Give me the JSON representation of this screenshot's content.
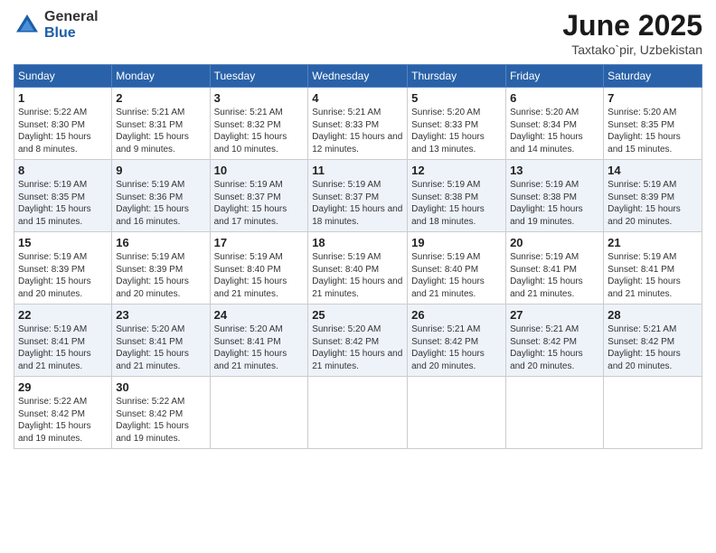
{
  "logo": {
    "general": "General",
    "blue": "Blue"
  },
  "title": "June 2025",
  "location": "Taxtako`pir, Uzbekistan",
  "headers": [
    "Sunday",
    "Monday",
    "Tuesday",
    "Wednesday",
    "Thursday",
    "Friday",
    "Saturday"
  ],
  "weeks": [
    [
      {
        "day": "1",
        "sunrise": "5:22 AM",
        "sunset": "8:30 PM",
        "daylight": "15 hours and 8 minutes."
      },
      {
        "day": "2",
        "sunrise": "5:21 AM",
        "sunset": "8:31 PM",
        "daylight": "15 hours and 9 minutes."
      },
      {
        "day": "3",
        "sunrise": "5:21 AM",
        "sunset": "8:32 PM",
        "daylight": "15 hours and 10 minutes."
      },
      {
        "day": "4",
        "sunrise": "5:21 AM",
        "sunset": "8:33 PM",
        "daylight": "15 hours and 12 minutes."
      },
      {
        "day": "5",
        "sunrise": "5:20 AM",
        "sunset": "8:33 PM",
        "daylight": "15 hours and 13 minutes."
      },
      {
        "day": "6",
        "sunrise": "5:20 AM",
        "sunset": "8:34 PM",
        "daylight": "15 hours and 14 minutes."
      },
      {
        "day": "7",
        "sunrise": "5:20 AM",
        "sunset": "8:35 PM",
        "daylight": "15 hours and 15 minutes."
      }
    ],
    [
      {
        "day": "8",
        "sunrise": "5:19 AM",
        "sunset": "8:35 PM",
        "daylight": "15 hours and 15 minutes."
      },
      {
        "day": "9",
        "sunrise": "5:19 AM",
        "sunset": "8:36 PM",
        "daylight": "15 hours and 16 minutes."
      },
      {
        "day": "10",
        "sunrise": "5:19 AM",
        "sunset": "8:37 PM",
        "daylight": "15 hours and 17 minutes."
      },
      {
        "day": "11",
        "sunrise": "5:19 AM",
        "sunset": "8:37 PM",
        "daylight": "15 hours and 18 minutes."
      },
      {
        "day": "12",
        "sunrise": "5:19 AM",
        "sunset": "8:38 PM",
        "daylight": "15 hours and 18 minutes."
      },
      {
        "day": "13",
        "sunrise": "5:19 AM",
        "sunset": "8:38 PM",
        "daylight": "15 hours and 19 minutes."
      },
      {
        "day": "14",
        "sunrise": "5:19 AM",
        "sunset": "8:39 PM",
        "daylight": "15 hours and 20 minutes."
      }
    ],
    [
      {
        "day": "15",
        "sunrise": "5:19 AM",
        "sunset": "8:39 PM",
        "daylight": "15 hours and 20 minutes."
      },
      {
        "day": "16",
        "sunrise": "5:19 AM",
        "sunset": "8:39 PM",
        "daylight": "15 hours and 20 minutes."
      },
      {
        "day": "17",
        "sunrise": "5:19 AM",
        "sunset": "8:40 PM",
        "daylight": "15 hours and 21 minutes."
      },
      {
        "day": "18",
        "sunrise": "5:19 AM",
        "sunset": "8:40 PM",
        "daylight": "15 hours and 21 minutes."
      },
      {
        "day": "19",
        "sunrise": "5:19 AM",
        "sunset": "8:40 PM",
        "daylight": "15 hours and 21 minutes."
      },
      {
        "day": "20",
        "sunrise": "5:19 AM",
        "sunset": "8:41 PM",
        "daylight": "15 hours and 21 minutes."
      },
      {
        "day": "21",
        "sunrise": "5:19 AM",
        "sunset": "8:41 PM",
        "daylight": "15 hours and 21 minutes."
      }
    ],
    [
      {
        "day": "22",
        "sunrise": "5:19 AM",
        "sunset": "8:41 PM",
        "daylight": "15 hours and 21 minutes."
      },
      {
        "day": "23",
        "sunrise": "5:20 AM",
        "sunset": "8:41 PM",
        "daylight": "15 hours and 21 minutes."
      },
      {
        "day": "24",
        "sunrise": "5:20 AM",
        "sunset": "8:41 PM",
        "daylight": "15 hours and 21 minutes."
      },
      {
        "day": "25",
        "sunrise": "5:20 AM",
        "sunset": "8:42 PM",
        "daylight": "15 hours and 21 minutes."
      },
      {
        "day": "26",
        "sunrise": "5:21 AM",
        "sunset": "8:42 PM",
        "daylight": "15 hours and 20 minutes."
      },
      {
        "day": "27",
        "sunrise": "5:21 AM",
        "sunset": "8:42 PM",
        "daylight": "15 hours and 20 minutes."
      },
      {
        "day": "28",
        "sunrise": "5:21 AM",
        "sunset": "8:42 PM",
        "daylight": "15 hours and 20 minutes."
      }
    ],
    [
      {
        "day": "29",
        "sunrise": "5:22 AM",
        "sunset": "8:42 PM",
        "daylight": "15 hours and 19 minutes."
      },
      {
        "day": "30",
        "sunrise": "5:22 AM",
        "sunset": "8:42 PM",
        "daylight": "15 hours and 19 minutes."
      },
      null,
      null,
      null,
      null,
      null
    ]
  ]
}
